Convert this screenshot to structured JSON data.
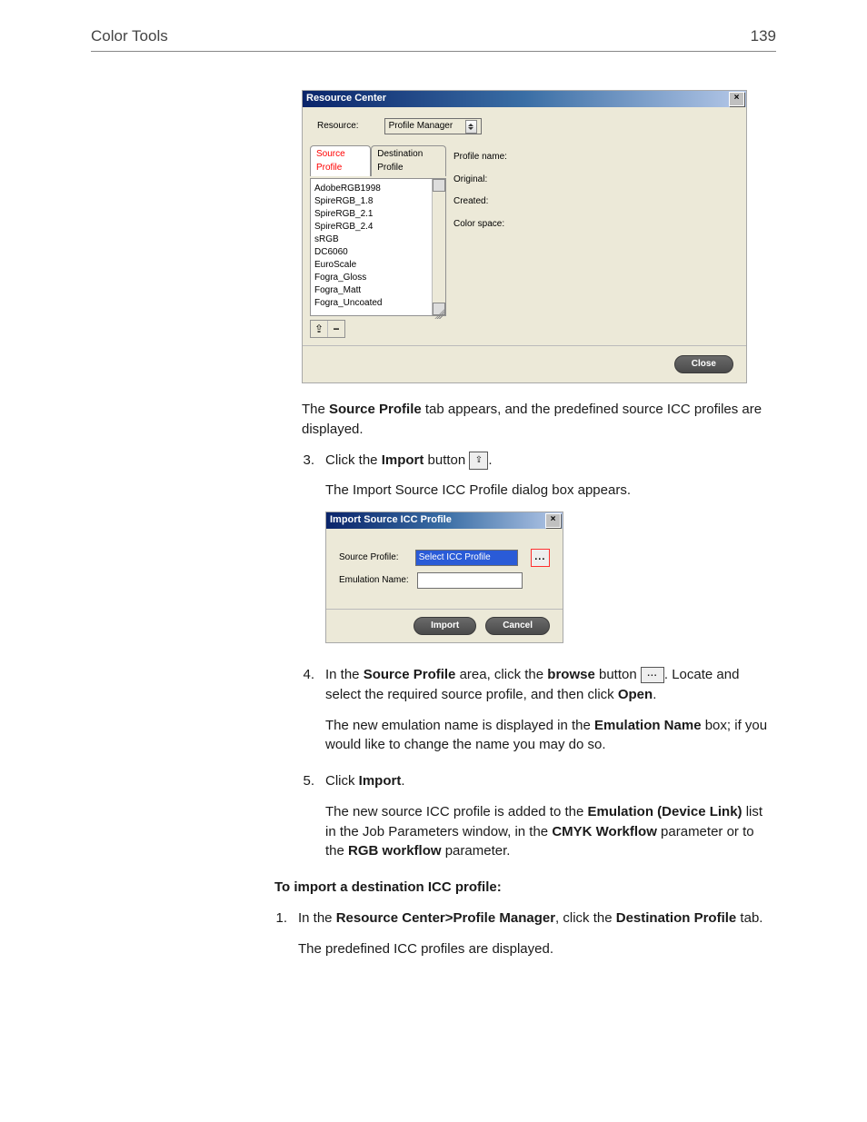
{
  "header": {
    "left": "Color Tools",
    "right": "139"
  },
  "shot1": {
    "title": "Resource Center",
    "resource_label": "Resource:",
    "resource_value": "Profile Manager",
    "tab_source": "Source Profile",
    "tab_dest": "Destination Profile",
    "profiles": [
      "AdobeRGB1998",
      "SpireRGB_1.8",
      "SpireRGB_2.1",
      "SpireRGB_2.4",
      "sRGB",
      "DC6060",
      "EuroScale",
      "Fogra_Gloss",
      "Fogra_Matt",
      "Fogra_Uncoated"
    ],
    "meta": {
      "name": "Profile name:",
      "original": "Original:",
      "created": "Created:",
      "colorspace": "Color space:"
    },
    "close": "Close",
    "import_icon": "⇪",
    "minus_icon": "−"
  },
  "para1a": "The ",
  "para1b": "Source Profile",
  "para1c": " tab appears, and the predefined source ICC profiles are displayed.",
  "step3": {
    "num": "3.",
    "a": "Click the ",
    "b": "Import",
    "c": " button ",
    "d": "."
  },
  "para2": "The Import Source ICC Profile dialog box appears.",
  "shot2": {
    "title": "Import Source ICC Profile",
    "label_source": "Source Profile:",
    "value_source": "Select ICC Profile",
    "label_emul": "Emulation Name:",
    "browse": "...",
    "import": "Import",
    "cancel": "Cancel"
  },
  "step4": {
    "num": "4.",
    "a": "In the ",
    "b": "Source Profile",
    "c": " area, click the ",
    "d": "browse",
    "e": " button ",
    "f": ". Locate and select the required source profile, and then click ",
    "g": "Open",
    "h": "."
  },
  "para4": {
    "a": "The new emulation name is displayed in the ",
    "b": "Emulation Name",
    "c": " box; if you would like to change the name you may do so."
  },
  "step5": {
    "num": "5.",
    "a": "Click ",
    "b": "Import",
    "c": "."
  },
  "para5": {
    "a": "The new source ICC profile is added to the ",
    "b": "Emulation (Device Link)",
    "c": " list in the Job Parameters window, in the ",
    "d": "CMYK Workflow",
    "e": " parameter or to the ",
    "f": "RGB workflow",
    "g": " parameter."
  },
  "subhead": "To import a destination ICC profile:",
  "stepD1": {
    "num": "1.",
    "a": "In the ",
    "b": "Resource Center>Profile Manager",
    "c": ", click the ",
    "d": "Destination Profile",
    "e": " tab."
  },
  "paraD": "The predefined ICC profiles are displayed."
}
